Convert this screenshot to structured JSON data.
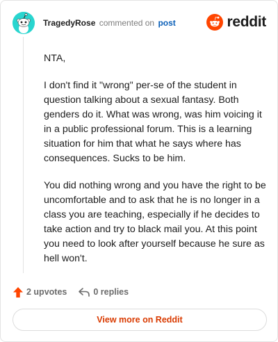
{
  "comment": {
    "username": "TragedyRose",
    "action_text": "commented on",
    "post_link_text": "post",
    "avatar_icon": "snoo-avatar-icon",
    "paragraphs": [
      "NTA,",
      "I don't find it \"wrong\" per-se of the student in question talking about a sexual fantasy. Both genders do it. What was wrong, was him voicing it in a public professional forum. This is a learning situation for him that what he says where has consequences. Sucks to be him.",
      "You did nothing wrong and you have the right to be uncomfortable and to ask that he is no longer in a class you are teaching, especially if he decides to take action and try to black mail you. At this point you need to look after yourself because he sure as hell won't."
    ]
  },
  "brand": {
    "wordmark": "reddit",
    "logo_icon": "reddit-logo-icon",
    "color": "#ff4500"
  },
  "actions": {
    "upvotes_label": "2 upvotes",
    "replies_label": "0 replies",
    "upvote_icon": "upvote-arrow-icon",
    "reply_icon": "reply-arrow-icon"
  },
  "footer": {
    "view_more_label": "View more on Reddit",
    "accent_color": "#d93a00"
  },
  "colors": {
    "avatar_bg": "#29d5cf",
    "link": "#0a5fb8",
    "upvote": "#ff4500"
  }
}
